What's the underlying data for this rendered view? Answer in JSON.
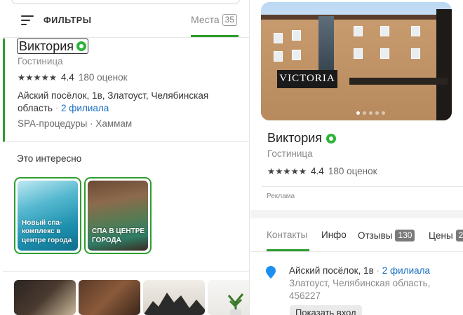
{
  "left": {
    "filter_label": "ФИЛЬТРЫ",
    "places_label": "Места",
    "places_count": "35",
    "card": {
      "name": "Виктория",
      "category": "Гостиница",
      "stars": "★★★★★",
      "rating": "4.4",
      "reviews": "180 оценок",
      "address": "Айский посёлок, 1в, Златоуст, Челябинская область",
      "dot": "·",
      "branches": "2 филиала",
      "tags": "SPA-процедуры · Хаммам"
    },
    "interest": {
      "title": "Это интересно",
      "stories": [
        {
          "caption": "Новый спа-комплекс в центре города"
        },
        {
          "caption": "СПА В ЦЕНТРЕ ГОРОДА"
        }
      ]
    }
  },
  "right": {
    "photo_sign": "VICTORIA",
    "name": "Виктория",
    "category": "Гостиница",
    "stars": "★★★★★",
    "rating": "4.4",
    "reviews": "180 оценок",
    "ad_label": "Реклама",
    "tabs": [
      {
        "label": "Контакты"
      },
      {
        "label": "Инфо"
      },
      {
        "label": "Отзывы",
        "badge": "130"
      },
      {
        "label": "Цены",
        "badge": "2"
      }
    ],
    "address_main": "Айский посёлок, 1в",
    "address_dot": "·",
    "branches": "2 филиала",
    "address_sub": "Златоуст, Челябинская область, 456227",
    "entrance_button": "Показать вход"
  },
  "colors": {
    "accent": "#2e9d2e",
    "link": "#1a6fc2",
    "verified": "#2fb33b",
    "pin": "#1a8ff0"
  }
}
